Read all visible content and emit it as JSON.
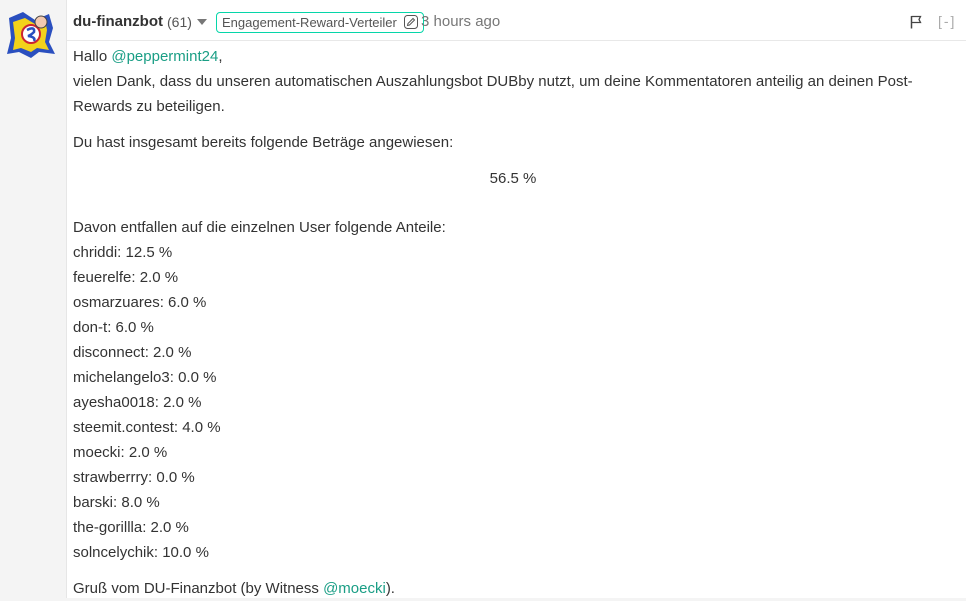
{
  "post": {
    "author": "du-finanzbot",
    "reputation": "(61)",
    "tag": "Engagement-Reward-Verteiler",
    "time": "3 hours ago",
    "collapse": "[-]"
  },
  "content": {
    "greeting": "Hallo ",
    "mention_user": "@peppermint24",
    "greeting_suffix": ",",
    "intro": "vielen Dank, dass du unseren automatischen Auszahlungsbot DUBby nutzt, um deine Kommentatoren anteilig an deinen Post-Rewards zu beteiligen.",
    "total_label": "Du hast insgesamt bereits folgende Beträge angewiesen:",
    "total_value": "56.5 %",
    "split_label": "Davon entfallen auf die einzelnen User folgende Anteile:",
    "shares": [
      "chriddi: 12.5 %",
      "feuerelfe: 2.0 %",
      "osmarzuares: 6.0 %",
      "don-t: 6.0 %",
      "disconnect: 2.0 %",
      "michelangelo3: 0.0 %",
      "ayesha0018: 2.0 %",
      "steemit.contest: 4.0 %",
      "moecki: 2.0 %",
      "strawberrry: 0.0 %",
      "barski: 8.0 %",
      "the-gorillla: 2.0 %",
      "solncelychik: 10.0 %"
    ],
    "footer_prefix": "Gruß vom DU-Finanzbot (by Witness ",
    "footer_mention": "@moecki",
    "footer_suffix": ")."
  },
  "icons": {
    "avatar": "bot-avatar-icon",
    "dropdown": "chevron-down-icon",
    "tag_edit": "pencil-icon",
    "flag": "flag-icon"
  },
  "colors": {
    "accent": "#06d6a9",
    "mention": "#1a9e85"
  }
}
